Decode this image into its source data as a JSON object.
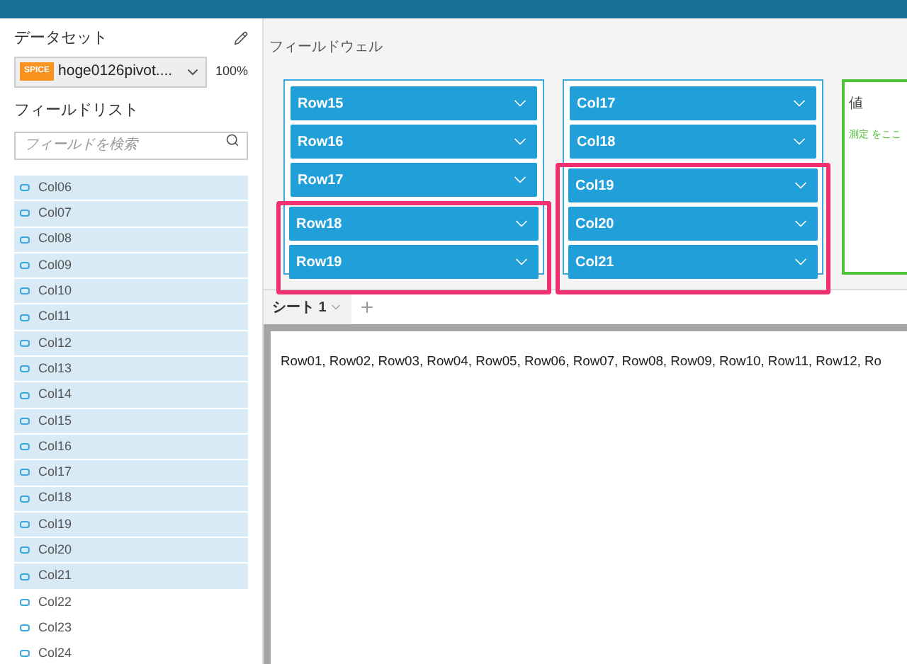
{
  "sidebar": {
    "dataset_label": "データセット",
    "dataset": {
      "badge": "SPICE",
      "name": "hoge0126pivot....",
      "percent": "100%"
    },
    "field_list_label": "フィールドリスト",
    "search": {
      "placeholder": "フィールドを検索"
    },
    "fields": [
      {
        "name": "Col06",
        "selected": true
      },
      {
        "name": "Col07",
        "selected": true
      },
      {
        "name": "Col08",
        "selected": true
      },
      {
        "name": "Col09",
        "selected": true
      },
      {
        "name": "Col10",
        "selected": true
      },
      {
        "name": "Col11",
        "selected": true
      },
      {
        "name": "Col12",
        "selected": true
      },
      {
        "name": "Col13",
        "selected": true
      },
      {
        "name": "Col14",
        "selected": true
      },
      {
        "name": "Col15",
        "selected": true
      },
      {
        "name": "Col16",
        "selected": true
      },
      {
        "name": "Col17",
        "selected": true
      },
      {
        "name": "Col18",
        "selected": true
      },
      {
        "name": "Col19",
        "selected": true
      },
      {
        "name": "Col20",
        "selected": true
      },
      {
        "name": "Col21",
        "selected": true
      },
      {
        "name": "Col22",
        "selected": false
      },
      {
        "name": "Col23",
        "selected": false
      },
      {
        "name": "Col24",
        "selected": false
      }
    ]
  },
  "field_wells": {
    "title": "フィールドウェル",
    "wells": [
      {
        "items": [
          {
            "label": "Row15",
            "highlighted": false
          },
          {
            "label": "Row16",
            "highlighted": false
          },
          {
            "label": "Row17",
            "highlighted": false
          },
          {
            "label": "Row18",
            "highlighted": true
          },
          {
            "label": "Row19",
            "highlighted": true
          }
        ]
      },
      {
        "items": [
          {
            "label": "Col17",
            "highlighted": false
          },
          {
            "label": "Col18",
            "highlighted": false
          },
          {
            "label": "Col19",
            "highlighted": true
          },
          {
            "label": "Col20",
            "highlighted": true
          },
          {
            "label": "Col21",
            "highlighted": true
          }
        ]
      }
    ],
    "values": {
      "title": "値",
      "hint": "測定 をここ"
    }
  },
  "sheet_tabs": [
    {
      "label": "シート 1",
      "selected": true
    }
  ],
  "canvas": {
    "text": "Row01, Row02, Row03, Row04, Row05, Row06, Row07, Row08, Row09, Row10, Row11, Row12, Ro"
  }
}
